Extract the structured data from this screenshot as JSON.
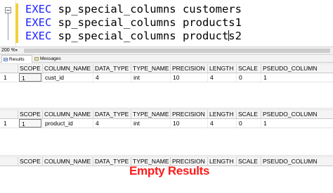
{
  "editor": {
    "lines": [
      {
        "keyword": "EXEC",
        "text": " sp_special_columns customers"
      },
      {
        "keyword": "EXEC",
        "text": " sp_special_columns products1"
      },
      {
        "keyword": "EXEC",
        "text_before_caret": " sp_special_columns product",
        "text_after_caret": "s2"
      }
    ],
    "keyword_color": "#1f22ff",
    "change_bar_color": "#f2cf3c"
  },
  "zoom": {
    "level": "200 %"
  },
  "tabs": [
    {
      "label": "Results",
      "icon": "grid-icon",
      "active": true
    },
    {
      "label": "Messages",
      "icon": "messages-icon",
      "active": false
    }
  ],
  "columns": [
    "SCOPE",
    "COLUMN_NAME",
    "DATA_TYPE",
    "TYPE_NAME",
    "PRECISION",
    "LENGTH",
    "SCALE",
    "PSEUDO_COLUMN"
  ],
  "results": [
    {
      "row_num": "1",
      "cells": [
        "1",
        "cust_id",
        "4",
        "int",
        "10",
        "4",
        "0",
        "1"
      ]
    },
    {
      "row_num": "1",
      "cells": [
        "1",
        "product_id",
        "4",
        "int",
        "10",
        "4",
        "0",
        "1"
      ]
    },
    {
      "empty": true
    }
  ],
  "annotation": {
    "text": "Empty Results",
    "color": "#ff1a1a"
  }
}
